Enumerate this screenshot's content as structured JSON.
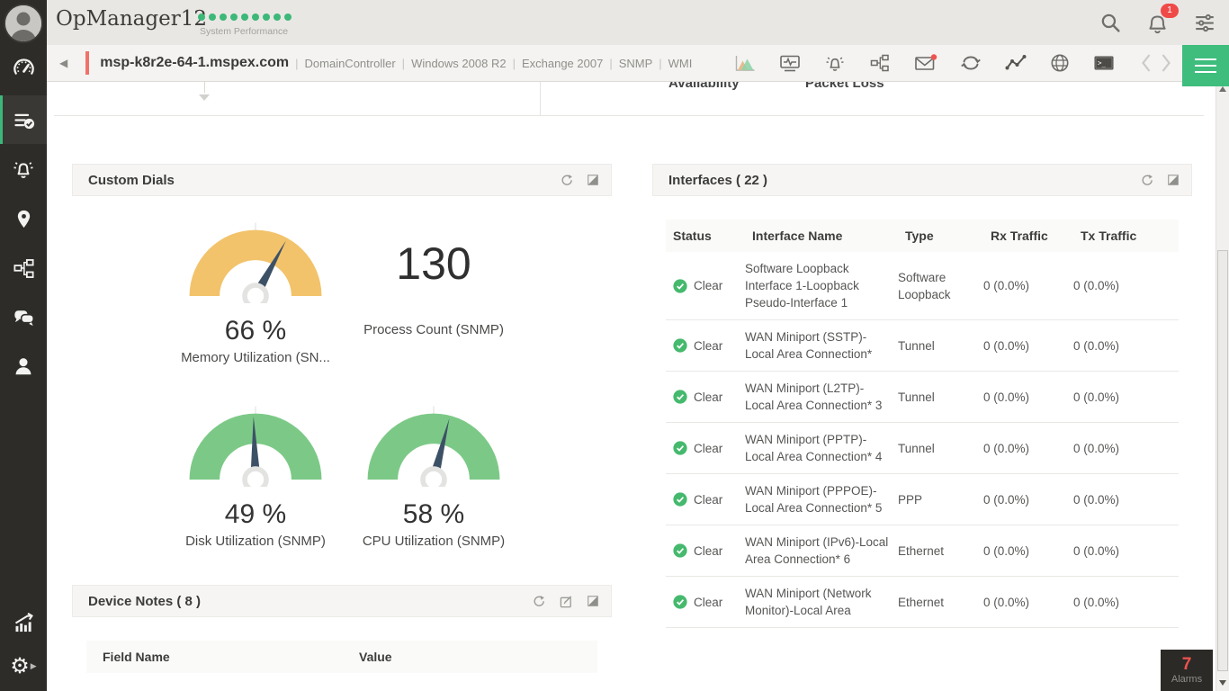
{
  "header": {
    "logo": "OpManager12",
    "subtitle": "System Performance",
    "status_dot_count": 9,
    "notification_count": "1",
    "topbar_icons": [
      "search-icon",
      "notifications-bell-icon",
      "settings-sliders-icon"
    ]
  },
  "device_bar": {
    "name": "msp-k8r2e-64-1.mspex.com",
    "attributes": [
      "DomainController",
      "Windows 2008 R2",
      "Exchange 2007",
      "SNMP",
      "WMI"
    ],
    "toolbar_icons": [
      "performance-chart-icon",
      "monitor-pulse-icon",
      "alarm-bell-icon",
      "workflow-icon",
      "mail-icon",
      "sync-loop-icon",
      "line-graph-icon",
      "web-globe-icon",
      "terminal-icon",
      "chevron-left-icon",
      "chevron-right-icon",
      "menu-hamburger-icon"
    ]
  },
  "sidebar_icons": [
    "avatar",
    "speedometer-icon",
    "inventory-list-check-icon",
    "alarm-bell-icon",
    "location-pin-icon",
    "workflow-icon",
    "chat-icon",
    "user-icon",
    "reports-chart-icon",
    "settings-gear-icon"
  ],
  "background_labels": {
    "left": "Availability",
    "right": "Packet Loss"
  },
  "panels": {
    "custom_dials": {
      "title": "Custom Dials",
      "dials": [
        {
          "kind": "gauge",
          "value": 66,
          "display": "66 %",
          "label": "Memory Utilization (SN...",
          "color": "#f2c36b"
        },
        {
          "kind": "number",
          "display": "130",
          "label": "Process Count (SNMP)"
        },
        {
          "kind": "gauge",
          "value": 49,
          "display": "49 %",
          "label": "Disk Utilization (SNMP)",
          "color": "#7cc987"
        },
        {
          "kind": "gauge",
          "value": 58,
          "display": "58 %",
          "label": "CPU Utilization (SNMP)",
          "color": "#7cc987"
        }
      ]
    },
    "device_notes": {
      "title": "Device Notes ( 8 )",
      "columns": [
        "Field Name",
        "Value"
      ]
    },
    "interfaces": {
      "title": "Interfaces ( 22 )",
      "columns": [
        "Status",
        "Interface Name",
        "Type",
        "Rx Traffic",
        "Tx Traffic"
      ],
      "rows": [
        {
          "status": "Clear",
          "name": "Software Loopback Interface 1-Loopback Pseudo-Interface 1",
          "type": "Software Loopback",
          "rx": "0 (0.0%)",
          "tx": "0 (0.0%)"
        },
        {
          "status": "Clear",
          "name": "WAN Miniport (SSTP)-Local Area Connection*",
          "type": "Tunnel",
          "rx": "0 (0.0%)",
          "tx": "0 (0.0%)"
        },
        {
          "status": "Clear",
          "name": "WAN Miniport (L2TP)-Local Area Connection* 3",
          "type": "Tunnel",
          "rx": "0 (0.0%)",
          "tx": "0 (0.0%)"
        },
        {
          "status": "Clear",
          "name": "WAN Miniport (PPTP)-Local Area Connection* 4",
          "type": "Tunnel",
          "rx": "0 (0.0%)",
          "tx": "0 (0.0%)"
        },
        {
          "status": "Clear",
          "name": "WAN Miniport (PPPOE)-Local Area Connection* 5",
          "type": "PPP",
          "rx": "0 (0.0%)",
          "tx": "0 (0.0%)"
        },
        {
          "status": "Clear",
          "name": "WAN Miniport (IPv6)-Local Area Connection* 6",
          "type": "Ethernet",
          "rx": "0 (0.0%)",
          "tx": "0 (0.0%)"
        },
        {
          "status": "Clear",
          "name": "WAN Miniport (Network Monitor)-Local Area",
          "type": "Ethernet",
          "rx": "0 (0.0%)",
          "tx": "0 (0.0%)"
        }
      ]
    }
  },
  "alarms": {
    "count": "7",
    "label": "Alarms"
  },
  "colors": {
    "accent_green": "#3cb878",
    "alert_red": "#ef5350",
    "gauge_orange": "#f2c36b",
    "gauge_green": "#7cc987",
    "needle_navy": "#3d5166",
    "sidebar_bg": "#2d2c29",
    "topbar_bg": "#e9e7e4"
  }
}
